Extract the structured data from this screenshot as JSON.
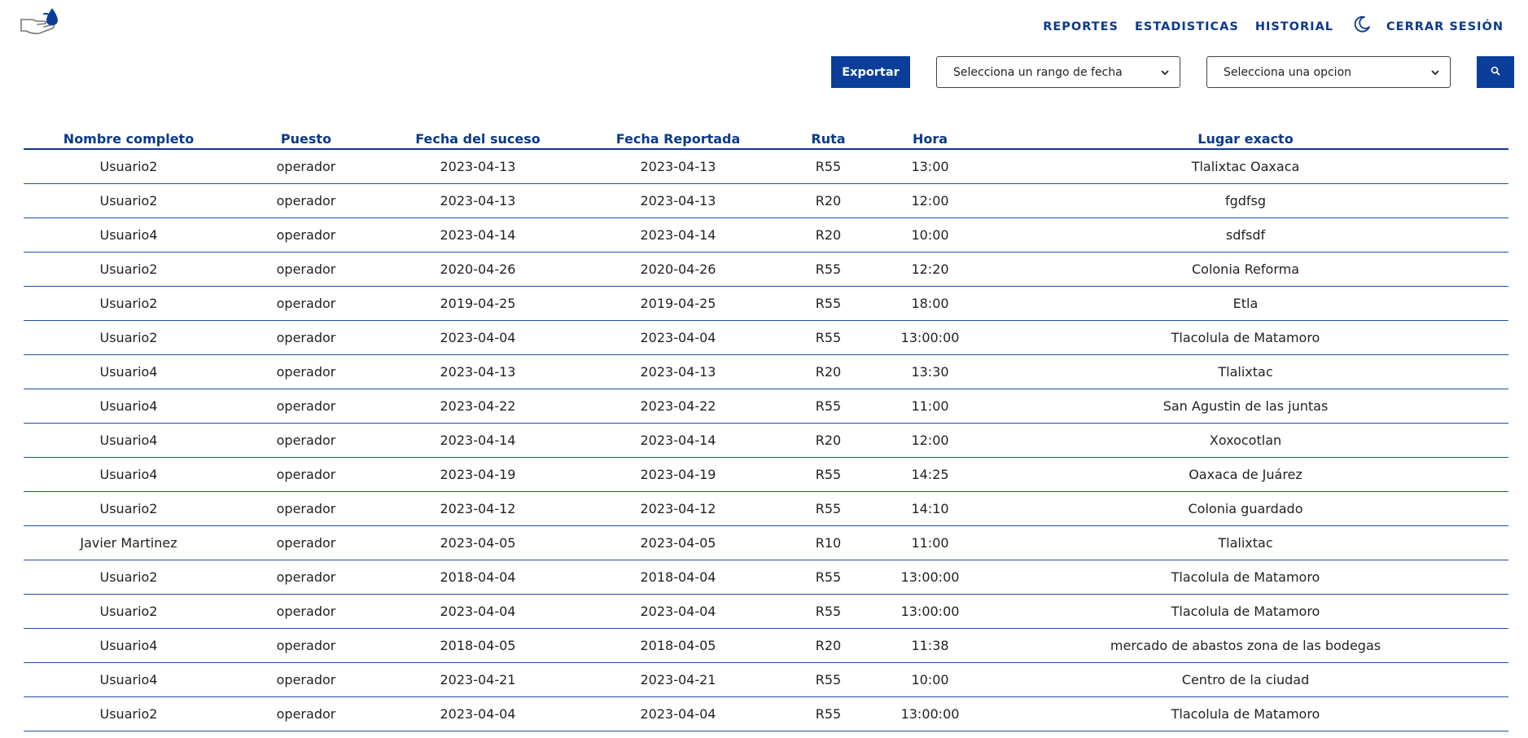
{
  "header": {
    "logo_icon": "hand-with-droplet-logo",
    "nav": [
      {
        "label": "REPORTES"
      },
      {
        "label": "ESTADISTICAS"
      },
      {
        "label": "HISTORIAL"
      }
    ],
    "theme_icon": "moon-icon",
    "logout_label": "CERRAR SESIÓN"
  },
  "toolbar": {
    "export_label": "Exportar",
    "date_range_select": "Selecciona un rango de fecha",
    "option_select": "Selecciona una opcion",
    "search_icon": "search-icon"
  },
  "colors": {
    "primary": "#0a3e9a",
    "text": "#222222",
    "header_text": "#0a3a8c"
  },
  "table": {
    "columns": [
      "Nombre completo",
      "Puesto",
      "Fecha del suceso",
      "Fecha Reportada",
      "Ruta",
      "Hora",
      "Lugar exacto"
    ],
    "rows": [
      [
        "Usuario2",
        "operador",
        "2023-04-13",
        "2023-04-13",
        "R55",
        "13:00",
        "Tlalixtac Oaxaca"
      ],
      [
        "Usuario2",
        "operador",
        "2023-04-13",
        "2023-04-13",
        "R20",
        "12:00",
        "fgdfsg"
      ],
      [
        "Usuario4",
        "operador",
        "2023-04-14",
        "2023-04-14",
        "R20",
        "10:00",
        "sdfsdf"
      ],
      [
        "Usuario2",
        "operador",
        "2020-04-26",
        "2020-04-26",
        "R55",
        "12:20",
        "Colonia Reforma"
      ],
      [
        "Usuario2",
        "operador",
        "2019-04-25",
        "2019-04-25",
        "R55",
        "18:00",
        "Etla"
      ],
      [
        "Usuario2",
        "operador",
        "2023-04-04",
        "2023-04-04",
        "R55",
        "13:00:00",
        "Tlacolula de Matamoro"
      ],
      [
        "Usuario4",
        "operador",
        "2023-04-13",
        "2023-04-13",
        "R20",
        "13:30",
        "Tlalixtac"
      ],
      [
        "Usuario4",
        "operador",
        "2023-04-22",
        "2023-04-22",
        "R55",
        "11:00",
        "San Agustin de las juntas"
      ],
      [
        "Usuario4",
        "operador",
        "2023-04-14",
        "2023-04-14",
        "R20",
        "12:00",
        "Xoxocotlan"
      ],
      [
        "Usuario4",
        "operador",
        "2023-04-19",
        "2023-04-19",
        "R55",
        "14:25",
        "Oaxaca de Juárez"
      ],
      [
        "Usuario2",
        "operador",
        "2023-04-12",
        "2023-04-12",
        "R55",
        "14:10",
        "Colonia guardado"
      ],
      [
        "Javier Martinez",
        "operador",
        "2023-04-05",
        "2023-04-05",
        "R10",
        "11:00",
        "Tlalixtac"
      ],
      [
        "Usuario2",
        "operador",
        "2018-04-04",
        "2018-04-04",
        "R55",
        "13:00:00",
        "Tlacolula de Matamoro"
      ],
      [
        "Usuario2",
        "operador",
        "2023-04-04",
        "2023-04-04",
        "R55",
        "13:00:00",
        "Tlacolula de Matamoro"
      ],
      [
        "Usuario4",
        "operador",
        "2018-04-05",
        "2018-04-05",
        "R20",
        "11:38",
        "mercado de abastos zona de las bodegas"
      ],
      [
        "Usuario4",
        "operador",
        "2023-04-21",
        "2023-04-21",
        "R55",
        "10:00",
        "Centro de la ciudad"
      ],
      [
        "Usuario2",
        "operador",
        "2023-04-04",
        "2023-04-04",
        "R55",
        "13:00:00",
        "Tlacolula de Matamoro"
      ]
    ]
  }
}
